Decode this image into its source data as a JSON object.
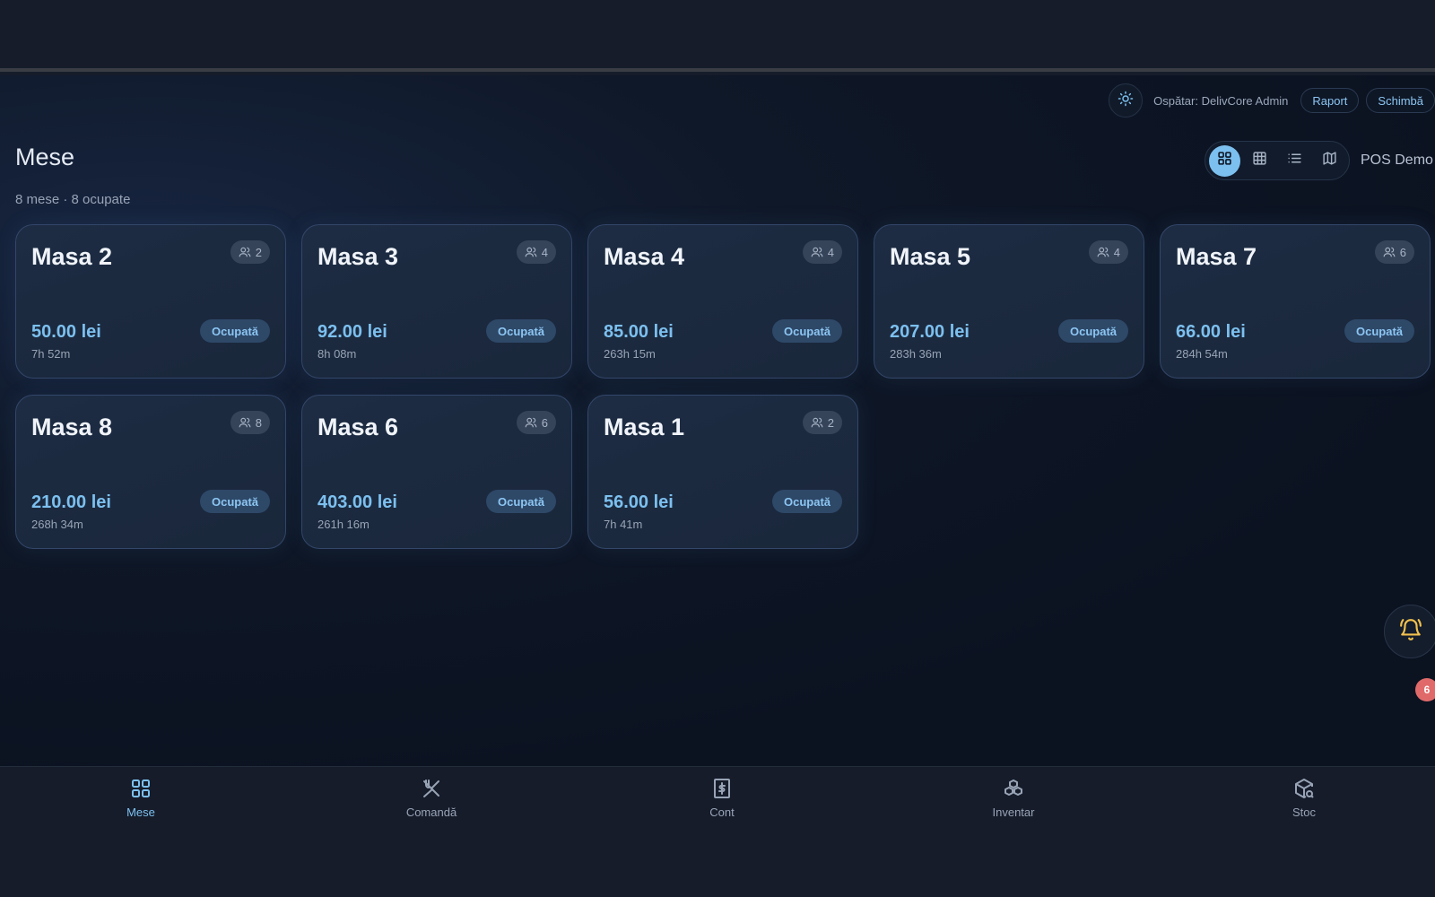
{
  "header": {
    "waiter_label": "Ospătar: DelivCore Admin",
    "report_label": "Raport",
    "switch_label": "Schimbă",
    "pos_label": "POS Demo"
  },
  "page": {
    "title": "Mese",
    "subtitle": "8 mese · 8 ocupate"
  },
  "view_modes": [
    "grid-icon",
    "table-icon",
    "list-icon",
    "map-icon"
  ],
  "active_view": "grid",
  "tables": [
    {
      "name": "Masa 2",
      "seats": "2",
      "amount": "50.00 lei",
      "duration": "7h 52m",
      "status": "Ocupată"
    },
    {
      "name": "Masa 3",
      "seats": "4",
      "amount": "92.00 lei",
      "duration": "8h 08m",
      "status": "Ocupată"
    },
    {
      "name": "Masa 4",
      "seats": "4",
      "amount": "85.00 lei",
      "duration": "263h 15m",
      "status": "Ocupată"
    },
    {
      "name": "Masa 5",
      "seats": "4",
      "amount": "207.00 lei",
      "duration": "283h 36m",
      "status": "Ocupată"
    },
    {
      "name": "Masa 7",
      "seats": "6",
      "amount": "66.00 lei",
      "duration": "284h 54m",
      "status": "Ocupată"
    },
    {
      "name": "Masa 8",
      "seats": "8",
      "amount": "210.00 lei",
      "duration": "268h 34m",
      "status": "Ocupată"
    },
    {
      "name": "Masa 6",
      "seats": "6",
      "amount": "403.00 lei",
      "duration": "261h 16m",
      "status": "Ocupată"
    },
    {
      "name": "Masa 1",
      "seats": "2",
      "amount": "56.00 lei",
      "duration": "7h 41m",
      "status": "Ocupată"
    }
  ],
  "notifications": {
    "count": "6"
  },
  "nav": [
    {
      "label": "Mese",
      "icon": "grid-icon",
      "active": true
    },
    {
      "label": "Comandă",
      "icon": "utensils-icon",
      "active": false
    },
    {
      "label": "Cont",
      "icon": "receipt-icon",
      "active": false
    },
    {
      "label": "Inventar",
      "icon": "boxes-icon",
      "active": false
    },
    {
      "label": "Stoc",
      "icon": "package-search-icon",
      "active": false
    }
  ],
  "colors": {
    "accent": "#7cc0ef",
    "status_bg": "#2e4868",
    "badge": "#e06a6a",
    "bell": "#f2c14e"
  }
}
